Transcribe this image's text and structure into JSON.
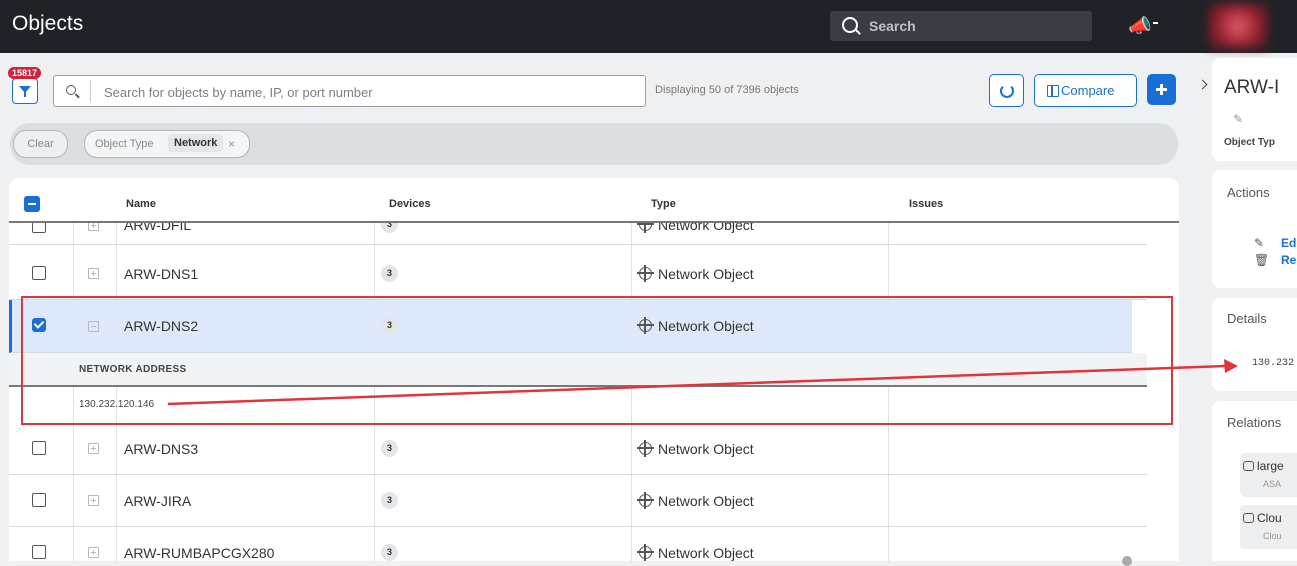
{
  "header": {
    "title": "Objects",
    "search_label": "Search"
  },
  "toolbar": {
    "filter_count": "15817",
    "search_placeholder": "Search for objects by name, IP, or port number",
    "display_count": "Displaying 50 of 7396 objects",
    "compare_label": "Compare"
  },
  "filters": {
    "clear_label": "Clear",
    "chip_key": "Object Type",
    "chip_value": "Network",
    "chip_close": "×"
  },
  "table": {
    "columns": [
      "Name",
      "Devices",
      "Type",
      "Issues"
    ],
    "rows": [
      {
        "name": "ARW-DFIL",
        "devices": "3",
        "type": "Network Object"
      },
      {
        "name": "ARW-DNS1",
        "devices": "3",
        "type": "Network Object"
      },
      {
        "name": "ARW-DNS2",
        "devices": "3",
        "type": "Network Object",
        "selected": true
      },
      {
        "name": "ARW-DNS3",
        "devices": "3",
        "type": "Network Object"
      },
      {
        "name": "ARW-JIRA",
        "devices": "3",
        "type": "Network Object"
      },
      {
        "name": "ARW-RUMBAPCGX280",
        "devices": "3",
        "type": "Network Object"
      }
    ],
    "expanded": {
      "header": "NETWORK ADDRESS",
      "value": "130.232.120.146"
    }
  },
  "right_panel": {
    "title": "ARW-I",
    "object_type_label": "Object Typ",
    "actions_label": "Actions",
    "action_edit": "Ed",
    "action_remove": "Re",
    "details_label": "Details",
    "details_address": "130.232",
    "relations_label": "Relations",
    "relations": [
      {
        "title": "large",
        "sub": "ASA"
      },
      {
        "title": "Clou",
        "sub": "Clou"
      }
    ]
  },
  "colors": {
    "accent": "#1a6fd6",
    "highlight_red": "#e0353b",
    "topbar": "#1f2226"
  }
}
